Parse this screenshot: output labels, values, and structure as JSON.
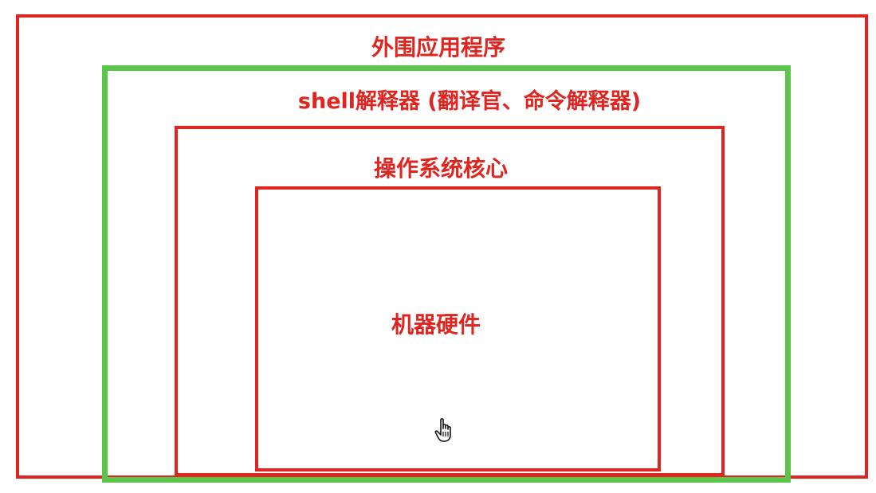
{
  "layers": {
    "outer_apps": {
      "label": "外围应用程序"
    },
    "shell": {
      "label": "shell解释器 (翻译官、命令解释器)"
    },
    "kernel": {
      "label": "操作系统核心"
    },
    "hardware": {
      "label": "机器硬件"
    }
  },
  "colors": {
    "layer_border": "#e0241f",
    "highlight_border": "#5bc44b",
    "label_text": "#e0241f"
  },
  "icons": {
    "pointer": "hand-pointer-icon"
  }
}
